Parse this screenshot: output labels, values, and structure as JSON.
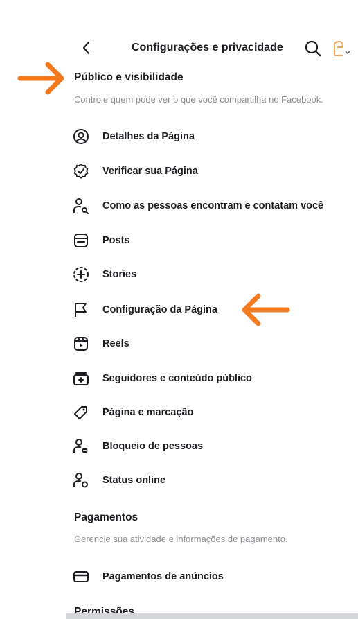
{
  "header": {
    "title": "Configurações e privacidade",
    "back_icon": "chevron-left-icon",
    "search_icon": "search-icon",
    "avatar_icon": "page-avatar-icon"
  },
  "sections": [
    {
      "title": "Público e visibilidade",
      "description": "Controle quem pode ver o que você compartilha no Facebook.",
      "items": [
        {
          "label": "Detalhes da Página",
          "icon": "user-circle-icon"
        },
        {
          "label": "Verificar sua Página",
          "icon": "verified-badge-icon"
        },
        {
          "label": "Como as pessoas encontram e contatam você",
          "icon": "person-search-icon"
        },
        {
          "label": "Posts",
          "icon": "posts-icon"
        },
        {
          "label": "Stories",
          "icon": "stories-add-icon"
        },
        {
          "label": "Configuração da Página",
          "icon": "flag-icon"
        },
        {
          "label": "Reels",
          "icon": "reels-icon"
        },
        {
          "label": "Seguidores e conteúdo público",
          "icon": "followers-box-icon"
        },
        {
          "label": "Página e marcação",
          "icon": "tag-icon"
        },
        {
          "label": "Bloqueio de pessoas",
          "icon": "person-block-icon"
        },
        {
          "label": "Status online",
          "icon": "person-status-icon"
        }
      ]
    },
    {
      "title": "Pagamentos",
      "description": "Gerencie sua atividade e informações de pagamento.",
      "items": [
        {
          "label": "Pagamentos de anúncios",
          "icon": "credit-card-icon"
        }
      ]
    },
    {
      "title": "Permissões"
    }
  ],
  "annotations": {
    "arrow_color": "#f47a20"
  }
}
